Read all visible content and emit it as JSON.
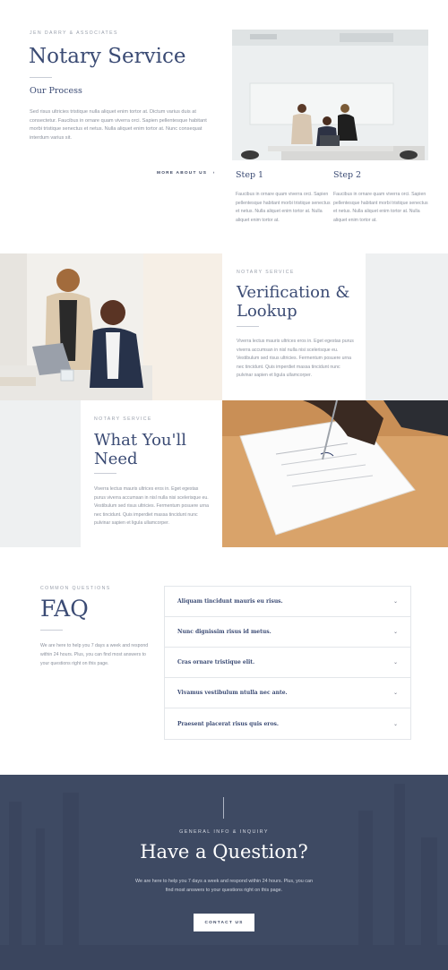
{
  "intro": {
    "eyebrow": "JEN DARRY & ASSOCIATES",
    "title": "Notary Service",
    "subtitle": "Our Process",
    "body": "Sed risus ultricies tristique nulla aliquet enim tortor at. Dictum varius duis at consectetur. Faucibus in ornare quam viverra orci. Sapien pellentesque habitant morbi tristique senectus et netus. Nulla aliquet enim tortor at. Nunc consequat interdum varius sit.",
    "more_link": "MORE ABOUT US",
    "more_arrow": "›"
  },
  "steps": [
    {
      "title": "Step 1",
      "body": "Faucibus in ornare quam viverra orci. Sapien pellentesque habitant morbi tristique senectus et netus. Nulla aliquet enim tortor at. Nulla aliquet enim tortor at."
    },
    {
      "title": "Step 2",
      "body": "Faucibus in ornare quam viverra orci. Sapien pellentesque habitant morbi tristique senectus et netus. Nulla aliquet enim tortor at. Nulla aliquet enim tortor at."
    }
  ],
  "verification": {
    "eyebrow": "NOTARY SERVICE",
    "title": "Verification & Lookup",
    "body": "Viverra lectus mauris ultrices eros in. Eget egestas purus viverra accumsan in nisl nulla nisi scelerisque eu. Vestibulum sed risus ultricies. Fermentum posuere urna nec tincidunt. Quis imperdiet massa tincidunt nunc pulvinar sapien et ligula ullamcorper."
  },
  "need": {
    "eyebrow": "NOTARY SERVICE",
    "title": "What You'll Need",
    "body": "Viverra lectus mauris ultrices eros in. Eget egestas purus viverra accumsan in nisl nulla nisi scelerisque eu. Vestibulum sed risus ultricies. Fermentum posuere urna nec tincidunt. Quis imperdiet massa tincidunt nunc pulvinar sapien et ligula ullamcorper."
  },
  "faq": {
    "eyebrow": "COMMON QUESTIONS",
    "title": "FAQ",
    "body": "We are here to help you 7 days a week and respond within 24 hours. Plus, you can find most answers to your questions right on this page.",
    "items": [
      {
        "question": "Aliquam tincidunt mauris eu risus."
      },
      {
        "question": "Nunc dignissim risus id metus."
      },
      {
        "question": "Cras ornare tristique elit."
      },
      {
        "question": "Vivamus vestibulum ntulla nec ante."
      },
      {
        "question": "Praesent placerat risus quis eros."
      }
    ],
    "chevron": "⌄"
  },
  "cta": {
    "eyebrow": "GENERAL INFO & INQUIRY",
    "title": "Have a Question?",
    "body": "We are here to help you 7 days a week and respond within 24 hours. Plus, you can find most answers to your questions right on this page.",
    "button": "CONTACT US"
  },
  "colors": {
    "heading": "#3b4b74",
    "cta_bg": "#3e4a63",
    "panel_gray": "#eef0f1"
  }
}
